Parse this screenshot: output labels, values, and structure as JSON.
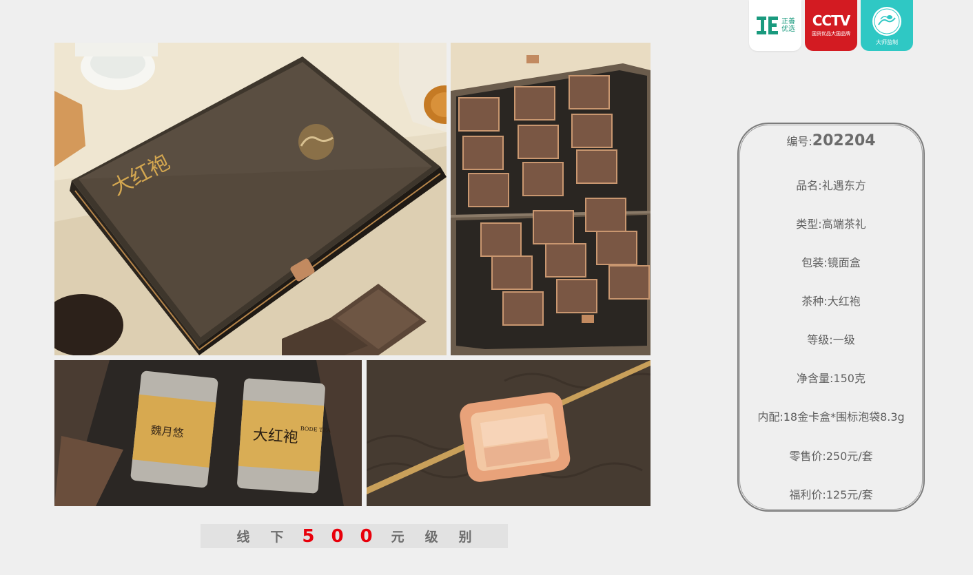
{
  "badges": [
    {
      "label_top": "正善",
      "label_bottom": "优选"
    },
    {
      "logo": "CCTV",
      "subtitle": "国货优品大国品牌"
    },
    {
      "subtitle": "大师监制"
    }
  ],
  "spec": {
    "code_label": "编号:",
    "code_value": "202204",
    "rows": [
      "品名:礼遇东方",
      "类型:高端茶礼",
      "包装:镜面盒",
      "茶种:大红袍",
      "等级:一级",
      "净含量:150克",
      "内配:18金卡盒*围标泡袋8.3g",
      "零售价:250元/套",
      "福利价:125元/套"
    ]
  },
  "level": {
    "prefix": [
      "线",
      "下"
    ],
    "digits": [
      "5",
      "0",
      "0"
    ],
    "suffix": [
      "元",
      "级",
      "别"
    ]
  },
  "product": {
    "box_title": "大红袍",
    "can1_label": "魏月悠",
    "can2_label": "大红袍",
    "brand": "BODE TEA"
  },
  "colors": {
    "accent_red": "#e8000b",
    "badge_green": "#1a9a7e",
    "badge_red": "#d31b22",
    "badge_teal": "#2fc8c4"
  }
}
